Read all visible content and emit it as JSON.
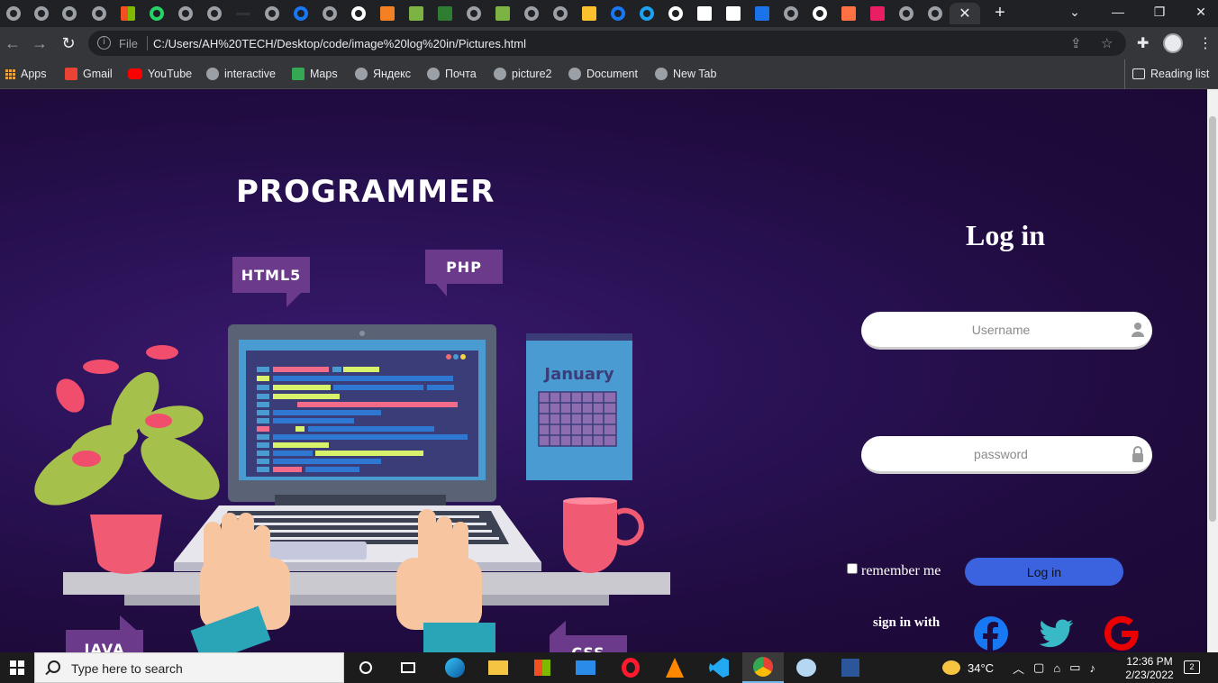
{
  "browser": {
    "address_scheme": "File",
    "address_url": "C:/Users/AH%20TECH/Desktop/code/image%20log%20in/Pictures.html",
    "bookmarks": [
      {
        "label": "Apps",
        "icon": "apps-grid-icon"
      },
      {
        "label": "Gmail",
        "icon": "gmail-icon"
      },
      {
        "label": "YouTube",
        "icon": "youtube-icon"
      },
      {
        "label": "interactive",
        "icon": "globe-icon"
      },
      {
        "label": "Maps",
        "icon": "maps-icon"
      },
      {
        "label": "Яндекс",
        "icon": "globe-icon"
      },
      {
        "label": "Почта",
        "icon": "globe-icon"
      },
      {
        "label": "picture2",
        "icon": "globe-icon"
      },
      {
        "label": "Document",
        "icon": "globe-icon"
      },
      {
        "label": "New Tab",
        "icon": "globe-icon"
      }
    ],
    "reading_list": "Reading list"
  },
  "illustration": {
    "title": "PROGRAMMER",
    "bubble_html": "HTML5",
    "bubble_php": "PHP",
    "bubble_java": "JAVA",
    "bubble_css": "CSS",
    "calendar_month": "January"
  },
  "login": {
    "title": "Log in",
    "username_placeholder": "Username",
    "password_placeholder": "password",
    "remember_label": "remember me",
    "button_label": "Log in",
    "signin_with": "sign in with"
  },
  "taskbar": {
    "search_placeholder": "Type here to search",
    "temperature": "34°C",
    "time": "12:36 PM",
    "date": "2/23/2022",
    "notification_count": "2"
  },
  "colors": {
    "page_background": "#1f0b3d",
    "login_button": "#3b63e0",
    "facebook": "#1877f2",
    "twitter": "#1da1f2",
    "google": "#ea0000"
  }
}
